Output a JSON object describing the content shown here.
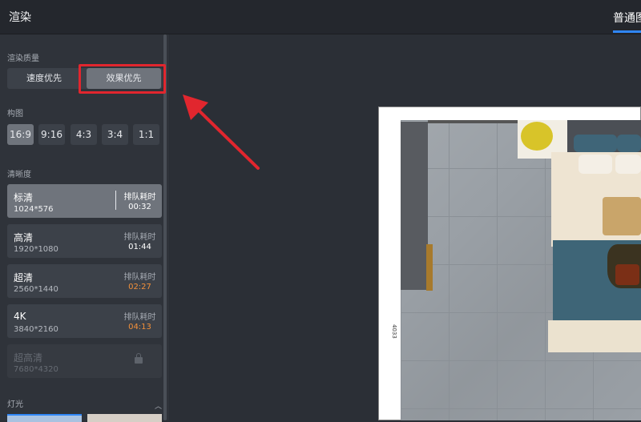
{
  "header": {
    "title": "渲染",
    "tab": "普通图"
  },
  "quality": {
    "label": "渲染质量",
    "options": [
      "速度优先",
      "效果优先"
    ],
    "selected": "效果优先"
  },
  "composition": {
    "label": "构图",
    "ratios": [
      "16:9",
      "9:16",
      "4:3",
      "3:4",
      "1:1"
    ],
    "selected": "16:9"
  },
  "clarity": {
    "label": "清晰度",
    "items": [
      {
        "name": "标清",
        "res": "1024*576",
        "wait_label": "排队耗时",
        "wait": "00:32"
      },
      {
        "name": "高清",
        "res": "1920*1080",
        "wait_label": "排队耗时",
        "wait": "01:44"
      },
      {
        "name": "超清",
        "res": "2560*1440",
        "wait_label": "排队耗时",
        "wait": "02:27"
      },
      {
        "name": "4K",
        "res": "3840*2160",
        "wait_label": "排队耗时",
        "wait": "04:13"
      },
      {
        "name": "超高清",
        "res": "7680*4320"
      }
    ],
    "selected": "标清",
    "wait_highlight_color": "#f2903a"
  },
  "lighting": {
    "label": "灯光"
  },
  "preview": {
    "dimension_label": "4033"
  },
  "colors": {
    "accent": "#2f86f6",
    "annotation": "#e1262e",
    "active_option": "#6f747c"
  },
  "icons": [
    "lock-icon",
    "chevron-up-icon",
    "arrow-annotation"
  ]
}
